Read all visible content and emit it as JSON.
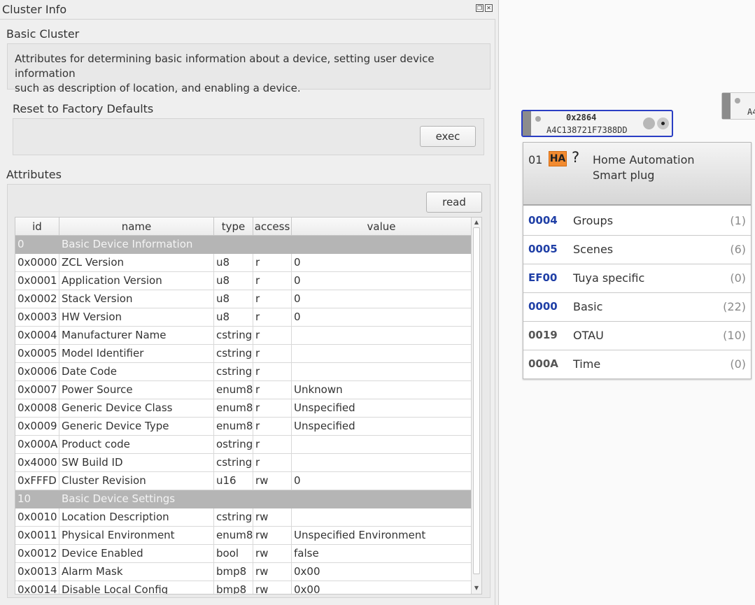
{
  "dock": {
    "title": "Cluster Info",
    "float_icon": "float-icon",
    "close_icon": "close-icon"
  },
  "cluster": {
    "name": "Basic Cluster",
    "description_line1": "Attributes for determining basic information about a device, setting user device information",
    "description_line2": "such as description of location, and enabling a device."
  },
  "commands": {
    "reset_label": "Reset to Factory Defaults",
    "exec_label": "exec"
  },
  "attributes": {
    "label": "Attributes",
    "read_label": "read",
    "columns": [
      "id",
      "name",
      "type",
      "access",
      "value"
    ],
    "rows": [
      {
        "group": true,
        "id": "0",
        "name": "Basic Device Information"
      },
      {
        "id": "0x0000",
        "name": "ZCL Version",
        "type": "u8",
        "access": "r",
        "value": "0"
      },
      {
        "id": "0x0001",
        "name": "Application Version",
        "type": "u8",
        "access": "r",
        "value": "0"
      },
      {
        "id": "0x0002",
        "name": "Stack Version",
        "type": "u8",
        "access": "r",
        "value": "0"
      },
      {
        "id": "0x0003",
        "name": "HW Version",
        "type": "u8",
        "access": "r",
        "value": "0"
      },
      {
        "id": "0x0004",
        "name": "Manufacturer Name",
        "type": "cstring",
        "access": "r",
        "value": ""
      },
      {
        "id": "0x0005",
        "name": "Model Identifier",
        "type": "cstring",
        "access": "r",
        "value": ""
      },
      {
        "id": "0x0006",
        "name": "Date Code",
        "type": "cstring",
        "access": "r",
        "value": ""
      },
      {
        "id": "0x0007",
        "name": "Power Source",
        "type": "enum8",
        "access": "r",
        "value": "Unknown"
      },
      {
        "id": "0x0008",
        "name": "Generic Device Class",
        "type": "enum8",
        "access": "r",
        "value": "Unspecified"
      },
      {
        "id": "0x0009",
        "name": "Generic Device Type",
        "type": "enum8",
        "access": "r",
        "value": "Unspecified"
      },
      {
        "id": "0x000A",
        "name": "Product code",
        "type": "ostring",
        "access": "r",
        "value": ""
      },
      {
        "id": "0x4000",
        "name": "SW Build ID",
        "type": "cstring",
        "access": "r",
        "value": ""
      },
      {
        "id": "0xFFFD",
        "name": "Cluster Revision",
        "type": "u16",
        "access": "rw",
        "value": "0"
      },
      {
        "group": true,
        "id": "10",
        "name": "Basic Device Settings"
      },
      {
        "id": "0x0010",
        "name": "Location Description",
        "type": "cstring",
        "access": "rw",
        "value": ""
      },
      {
        "id": "0x0011",
        "name": "Physical Environment",
        "type": "enum8",
        "access": "rw",
        "value": "Unspecified Environment"
      },
      {
        "id": "0x0012",
        "name": "Device Enabled",
        "type": "bool",
        "access": "rw",
        "value": "false"
      },
      {
        "id": "0x0013",
        "name": "Alarm Mask",
        "type": "bmp8",
        "access": "rw",
        "value": "0x00"
      },
      {
        "id": "0x0014",
        "name": "Disable Local Config",
        "type": "bmp8",
        "access": "rw",
        "value": "0x00"
      }
    ]
  },
  "node": {
    "nwk_address": "0x2864",
    "mac_address": "A4C138721F7388DD",
    "other_node_mac_fragment": "A4",
    "endpoint": "01",
    "profile_badge": "HA",
    "unknown_mark": "?",
    "profile_name": "Home Automation",
    "device_name": "Smart plug",
    "clusters": [
      {
        "id": "0004",
        "name": "Groups",
        "count": "(1)",
        "color": "#1f3fa6"
      },
      {
        "id": "0005",
        "name": "Scenes",
        "count": "(6)",
        "color": "#1f3fa6"
      },
      {
        "id": "EF00",
        "name": "Tuya specific",
        "count": "(0)",
        "color": "#1f3fa6"
      },
      {
        "id": "0000",
        "name": "Basic",
        "count": "(22)",
        "color": "#1f3fa6"
      },
      {
        "id": "0019",
        "name": "OTAU",
        "count": "(10)",
        "color": "#555555"
      },
      {
        "id": "000A",
        "name": "Time",
        "count": "(0)",
        "color": "#555555"
      }
    ]
  }
}
